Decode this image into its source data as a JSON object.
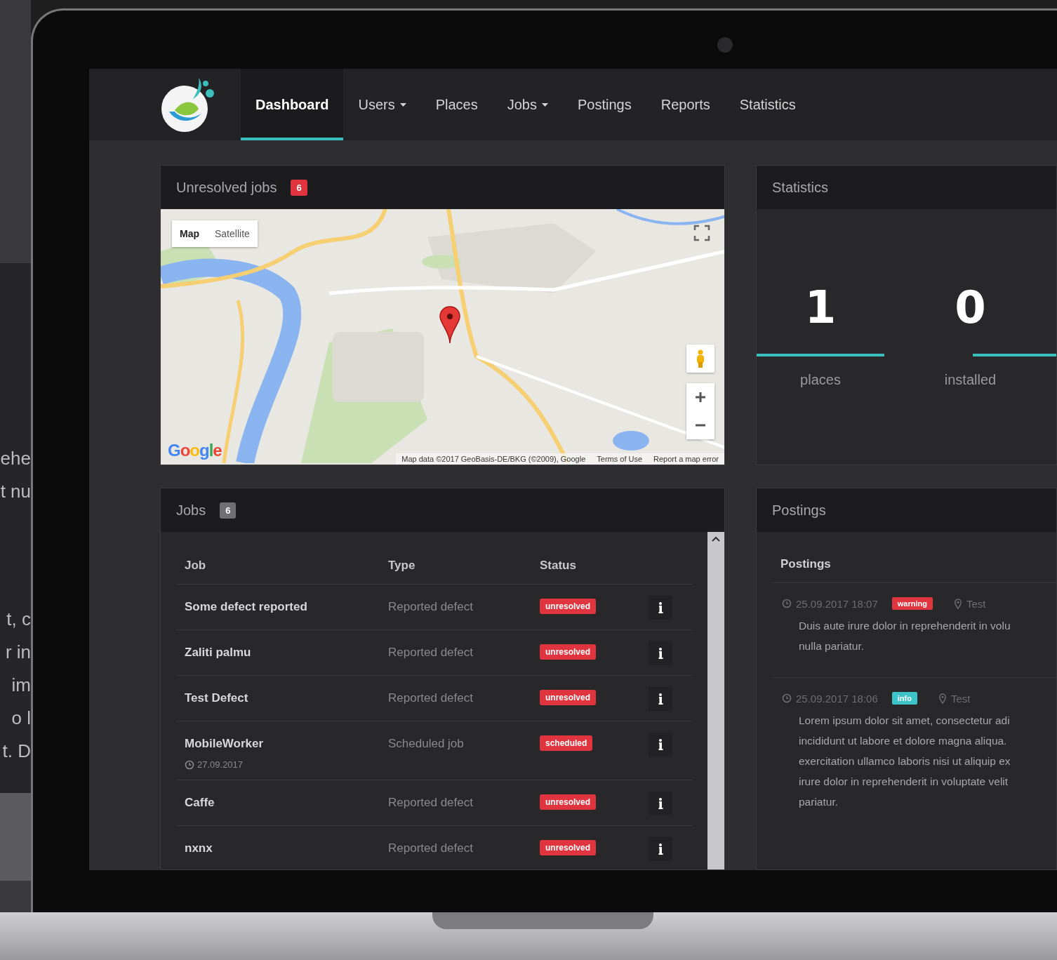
{
  "background_text": [
    "ehe",
    "t nu",
    "t, c",
    "r in",
    "im",
    "o l",
    "t. D"
  ],
  "nav": {
    "items": [
      {
        "label": "Dashboard",
        "selected": true,
        "dropdown": false
      },
      {
        "label": "Users",
        "selected": false,
        "dropdown": true
      },
      {
        "label": "Places",
        "selected": false,
        "dropdown": false
      },
      {
        "label": "Jobs",
        "selected": false,
        "dropdown": true
      },
      {
        "label": "Postings",
        "selected": false,
        "dropdown": false
      },
      {
        "label": "Reports",
        "selected": false,
        "dropdown": false
      },
      {
        "label": "Statistics",
        "selected": false,
        "dropdown": false
      }
    ]
  },
  "unresolved_panel": {
    "title": "Unresolved jobs",
    "count": "6",
    "map": {
      "map_types": [
        {
          "label": "Map",
          "selected": true
        },
        {
          "label": "Satellite",
          "selected": false
        }
      ],
      "logo": "Google",
      "attribution": "Map data ©2017 GeoBasis-DE/BKG (©2009), Google",
      "links": [
        "Terms of Use",
        "Report a map error"
      ]
    }
  },
  "statistics_panel": {
    "title": "Statistics",
    "stats": [
      {
        "value": "1",
        "label": "places"
      },
      {
        "value": "0",
        "label": "installed"
      }
    ]
  },
  "jobs_panel": {
    "title": "Jobs",
    "count": "6",
    "columns": [
      "Job",
      "Type",
      "Status"
    ],
    "rows": [
      {
        "job": "Some defect reported",
        "type": "Reported defect",
        "status": "unresolved"
      },
      {
        "job": "Zaliti palmu",
        "type": "Reported defect",
        "status": "unresolved"
      },
      {
        "job": "Test Defect",
        "type": "Reported defect",
        "status": "unresolved"
      },
      {
        "job": "MobileWorker",
        "date": "27.09.2017",
        "type": "Scheduled job",
        "status": "scheduled"
      },
      {
        "job": "Caffe",
        "type": "Reported defect",
        "status": "unresolved"
      },
      {
        "job": "nxnx",
        "type": "Reported defect",
        "status": "unresolved"
      }
    ]
  },
  "postings_panel": {
    "title": "Postings",
    "heading": "Postings",
    "items": [
      {
        "date": "25.09.2017 18:07",
        "tag": "warning",
        "color": "#e0353f",
        "location": "Test",
        "text": "Duis aute irure dolor in reprehenderit in volu\nnulla pariatur."
      },
      {
        "date": "25.09.2017 18:06",
        "tag": "info",
        "color": "#3cc4c8",
        "location": "Test",
        "text": "Lorem ipsum dolor sit amet, consectetur adi\nincididunt ut labore et dolore magna aliqua.\nexercitation ullamco laboris nisi ut aliquip ex\nirure dolor in reprehenderit in voluptate velit\npariatur."
      }
    ]
  }
}
